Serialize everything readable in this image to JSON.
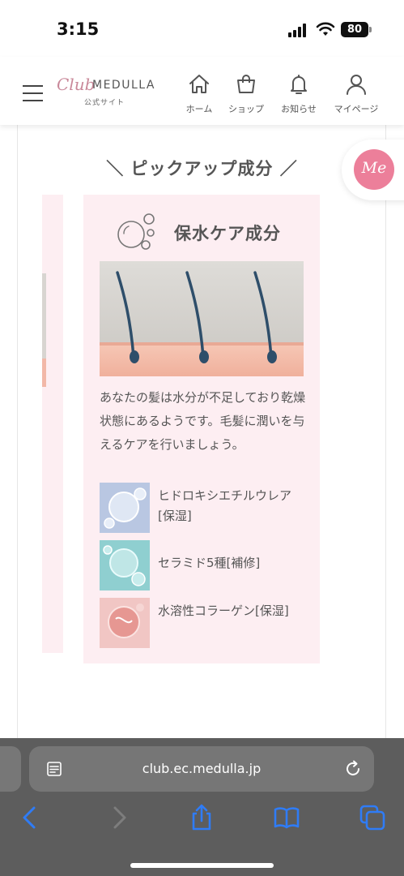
{
  "status": {
    "time": "3:15",
    "battery": "80"
  },
  "header": {
    "logo_script": "Club",
    "logo_main": "MEDULLA",
    "logo_sub": "公式サイト",
    "nav": [
      {
        "label": "ホーム",
        "icon": "home-icon"
      },
      {
        "label": "ショップ",
        "icon": "shop-bag-icon"
      },
      {
        "label": "お知らせ",
        "icon": "bell-icon"
      },
      {
        "label": "マイページ",
        "icon": "user-icon"
      }
    ]
  },
  "section": {
    "title": "＼ ピックアップ成分 ／"
  },
  "fab": {
    "label": "Me"
  },
  "card": {
    "title": "保水ケア成分",
    "description": "あなたの髪は水分が不足しており乾燥状態にあるようです。毛髪に潤いを与えるケアを行いましょう。",
    "ingredients": [
      {
        "label": "ヒドロキシエチルウレア[保湿]"
      },
      {
        "label": "セラミド5種[補修]"
      },
      {
        "label": "水溶性コラーゲン[保湿]"
      }
    ]
  },
  "browser": {
    "url": "club.ec.medulla.jp"
  },
  "colors": {
    "card_background": "#fdeef2",
    "accent_pink": "#ec7f9a",
    "browser_chrome": "#5d5d5d",
    "toolbar_blue": "#2f7cf6"
  }
}
